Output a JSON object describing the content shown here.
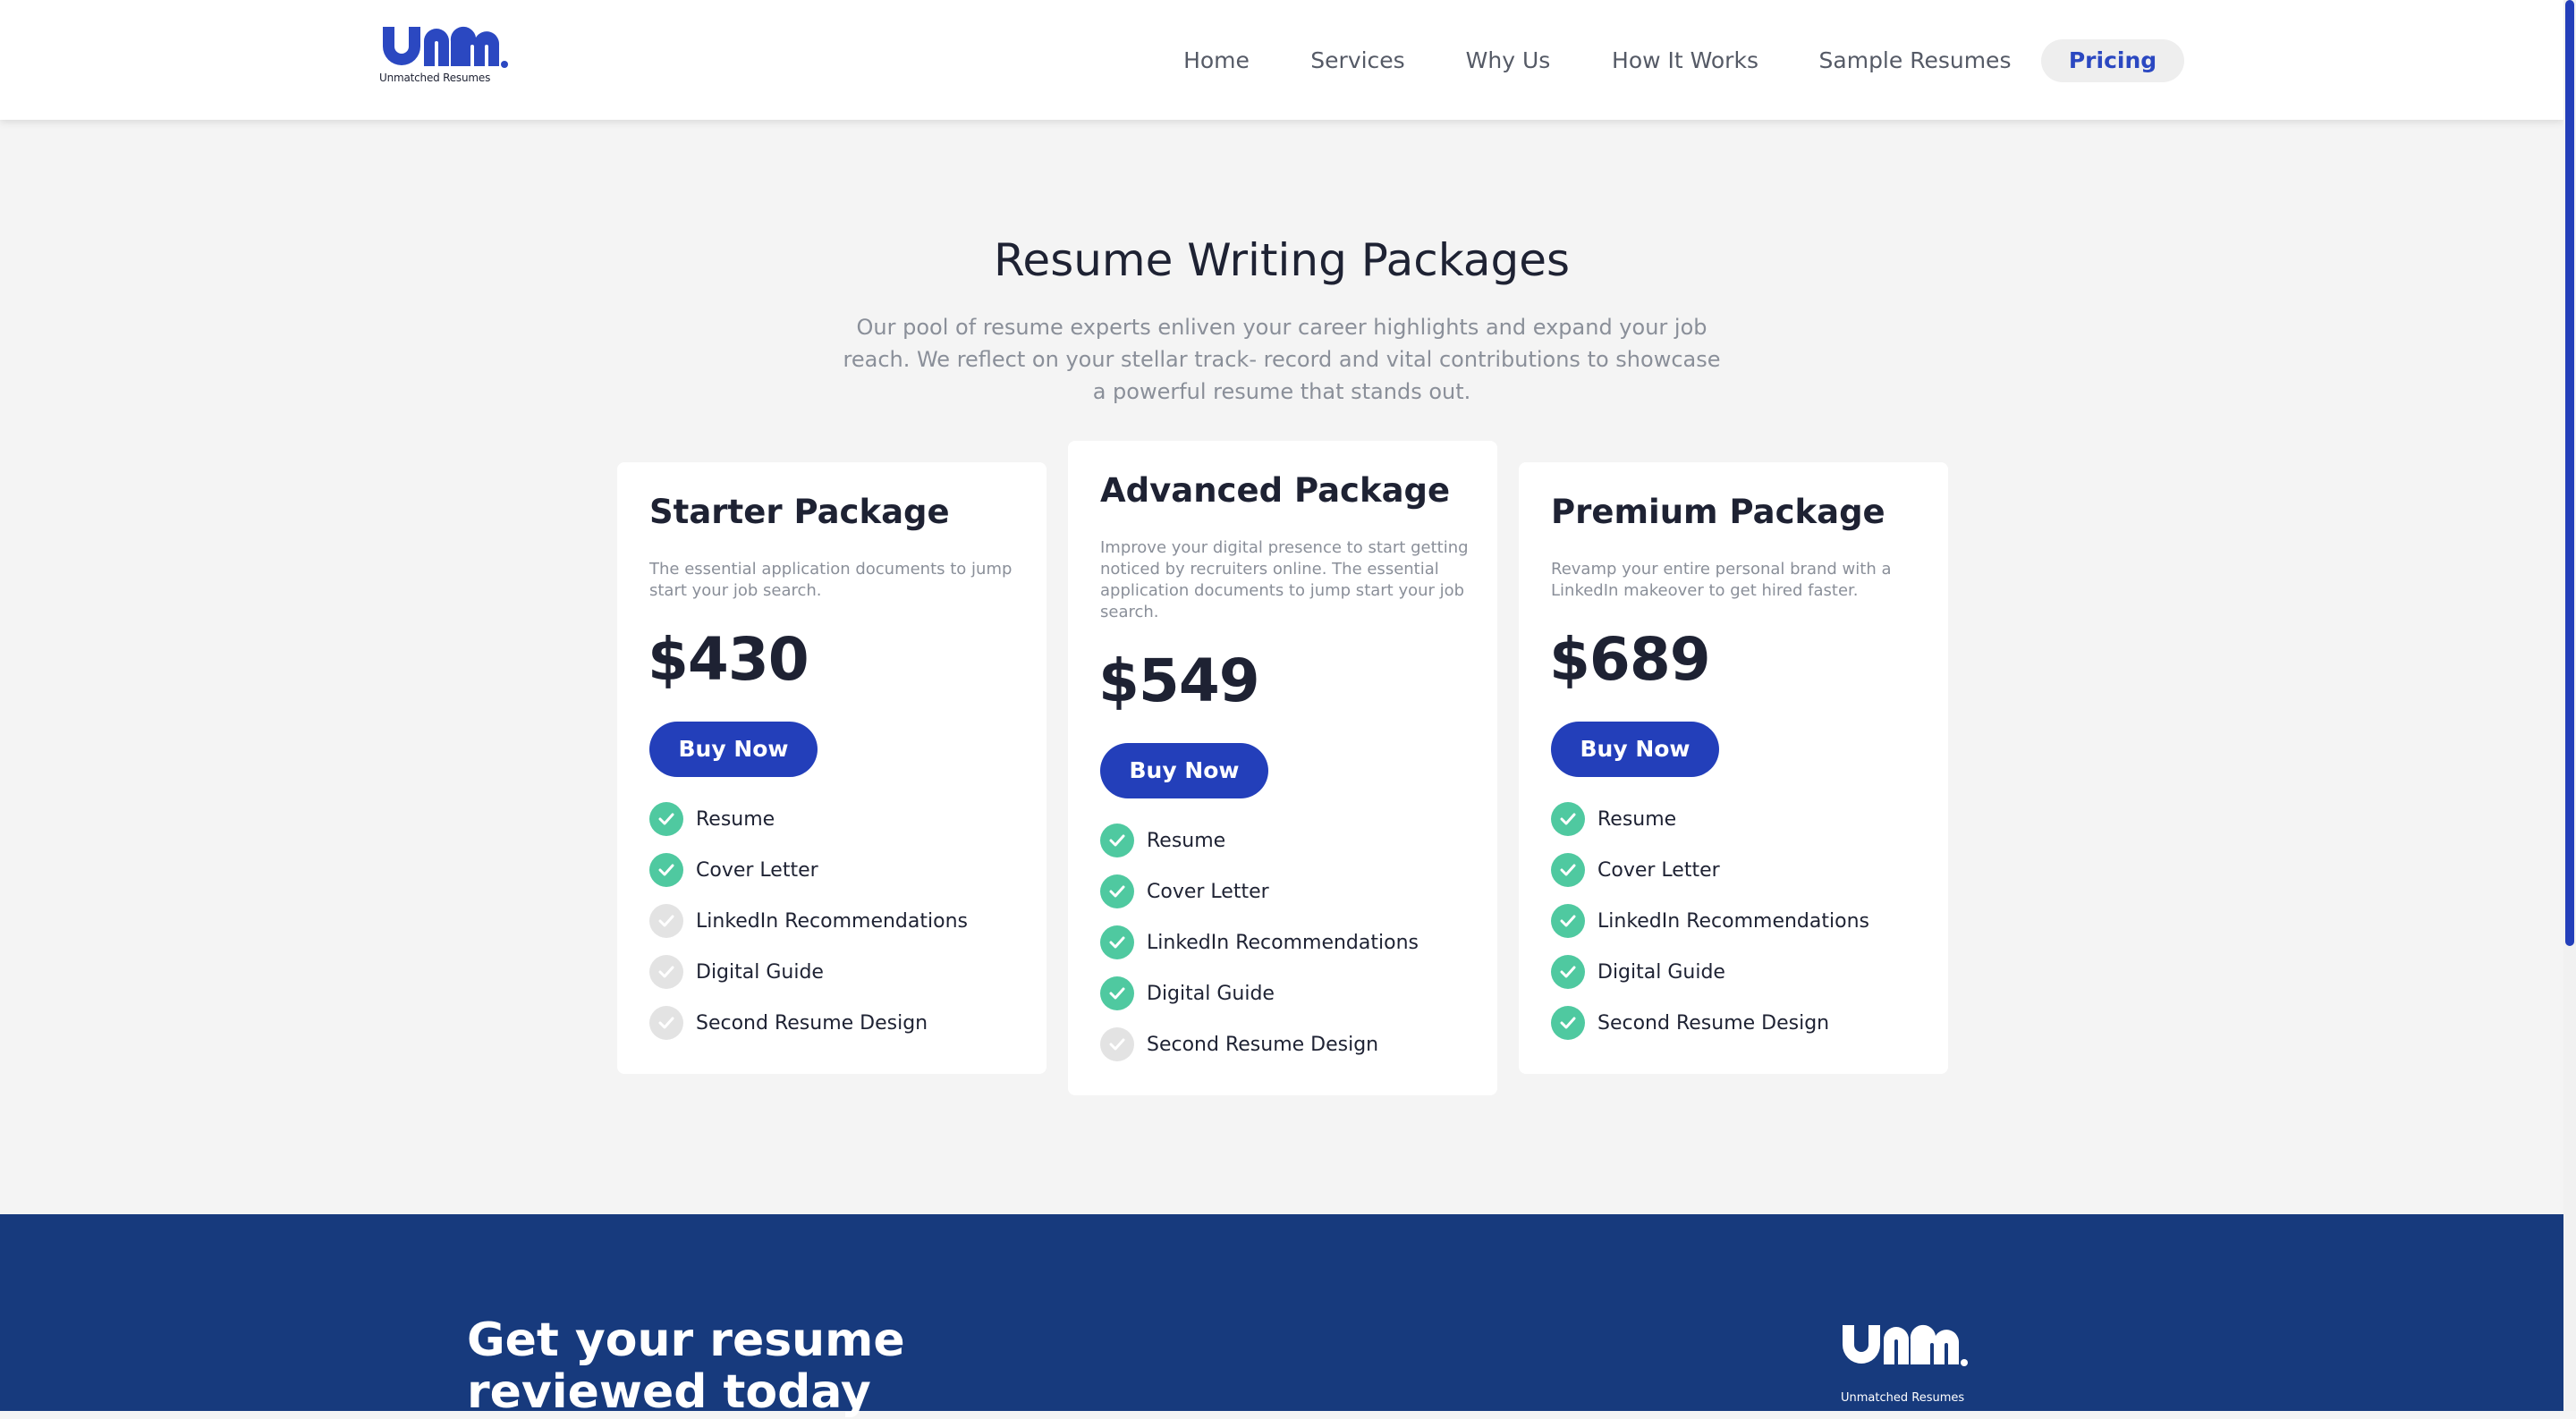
{
  "brand": {
    "logo_text": "UNM",
    "tagline": "Unmatched Resumes",
    "primary_color": "#233fba",
    "check_color": "#4fc9a0",
    "footer_color": "#173a7d"
  },
  "nav": {
    "items": [
      {
        "label": "Home"
      },
      {
        "label": "Services"
      },
      {
        "label": "Why Us"
      },
      {
        "label": "How It Works"
      },
      {
        "label": "Sample Resumes"
      },
      {
        "label": "Pricing",
        "active": true
      }
    ]
  },
  "pricing": {
    "title": "Resume Writing Packages",
    "subtitle": "Our pool of resume experts enliven your career highlights and expand your job reach. We reflect on your stellar track- record and vital contributions to showcase a powerful resume that stands out.",
    "cards": [
      {
        "title": "Starter Package",
        "description": "The essential application documents to jump start your job search.",
        "price": "$430",
        "button_label": "Buy Now",
        "features": [
          {
            "label": "Resume",
            "included": true
          },
          {
            "label": "Cover Letter",
            "included": true
          },
          {
            "label": "LinkedIn Recommendations",
            "included": false
          },
          {
            "label": "Digital Guide",
            "included": false
          },
          {
            "label": "Second Resume Design",
            "included": false
          }
        ]
      },
      {
        "title": "Advanced Package",
        "description": "Improve your digital presence to start getting noticed by recruiters online. The essential application documents to jump start your job search.",
        "price": "$549",
        "button_label": "Buy Now",
        "features": [
          {
            "label": "Resume",
            "included": true
          },
          {
            "label": "Cover Letter",
            "included": true
          },
          {
            "label": "LinkedIn Recommendations",
            "included": true
          },
          {
            "label": "Digital Guide",
            "included": true
          },
          {
            "label": "Second Resume Design",
            "included": false
          }
        ]
      },
      {
        "title": "Premium Package",
        "description": "Revamp your entire personal brand with a LinkedIn makeover to get hired faster.",
        "price": "$689",
        "button_label": "Buy Now",
        "features": [
          {
            "label": "Resume",
            "included": true
          },
          {
            "label": "Cover Letter",
            "included": true
          },
          {
            "label": "LinkedIn Recommendations",
            "included": true
          },
          {
            "label": "Digital Guide",
            "included": true
          },
          {
            "label": "Second Resume Design",
            "included": true
          }
        ]
      }
    ]
  },
  "footer": {
    "headline": "Get your resume reviewed today"
  }
}
